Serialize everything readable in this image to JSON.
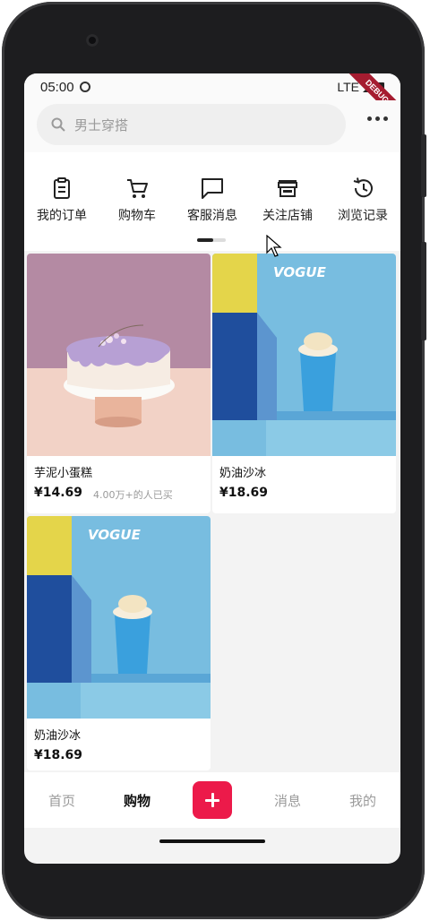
{
  "status_bar": {
    "time": "05:00",
    "network": "LTE",
    "debug_banner": "DEBUG"
  },
  "search": {
    "placeholder": "男士穿搭"
  },
  "shortcuts": [
    {
      "label": "我的订单",
      "icon": "clipboard-icon"
    },
    {
      "label": "购物车",
      "icon": "cart-icon"
    },
    {
      "label": "客服消息",
      "icon": "chat-icon"
    },
    {
      "label": "关注店铺",
      "icon": "store-icon"
    },
    {
      "label": "浏览记录",
      "icon": "history-icon"
    }
  ],
  "products": [
    {
      "name": "芋泥小蛋糕",
      "price": "¥14.69",
      "sold": "4.00万+的人已买",
      "image": "cake"
    },
    {
      "name": "奶油沙冰",
      "price": "¥18.69",
      "image": "drink",
      "brand": "VOGUE"
    },
    {
      "name": "奶油沙冰",
      "price": "¥18.69",
      "image": "drink",
      "brand": "VOGUE"
    }
  ],
  "bottom_nav": [
    {
      "label": "首页",
      "active": false
    },
    {
      "label": "购物",
      "active": true
    },
    {
      "label": "",
      "icon": "add-icon"
    },
    {
      "label": "消息",
      "active": false
    },
    {
      "label": "我的",
      "active": false
    }
  ],
  "colors": {
    "accent": "#ec1a4a",
    "drink_bg": "#78bde0",
    "cake_bg": "#b88aa4"
  }
}
